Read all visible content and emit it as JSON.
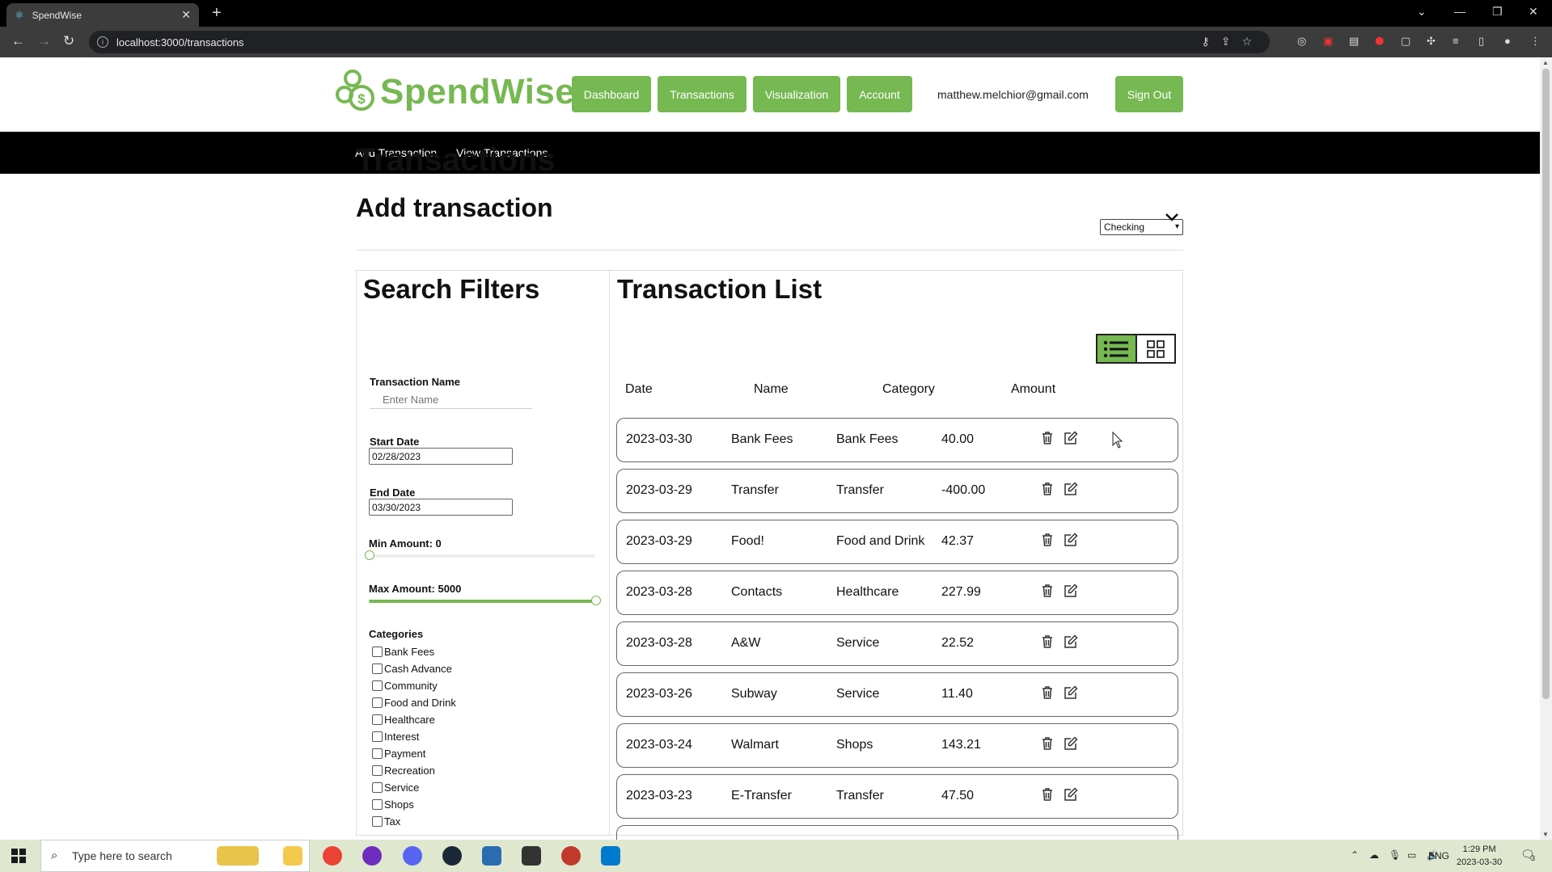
{
  "browser": {
    "tab_title": "SpendWise",
    "url": "localhost:3000/transactions"
  },
  "app": {
    "brand": "SpendWise",
    "nav": [
      "Dashboard",
      "Transactions",
      "Visualization",
      "Account"
    ],
    "user_email": "matthew.melchior@gmail.com",
    "sign_out": "Sign Out",
    "subnav": [
      "Add Transaction",
      "View Transactions"
    ],
    "accent_color": "#76b852"
  },
  "page": {
    "title": "Transactions",
    "account_selected": "Checking",
    "add_heading": "Add transaction"
  },
  "filters": {
    "title": "Search Filters",
    "name_label": "Transaction Name",
    "name_placeholder": "Enter Name",
    "start_label": "Start Date",
    "start_value": "02/28/2023",
    "end_label": "End Date",
    "end_value": "03/30/2023",
    "min_label": "Min Amount: 0",
    "min_value": 0,
    "max_label": "Max Amount: 5000",
    "max_value": 5000,
    "categories_label": "Categories",
    "categories": [
      "Bank Fees",
      "Cash Advance",
      "Community",
      "Food and Drink",
      "Healthcare",
      "Interest",
      "Payment",
      "Recreation",
      "Service",
      "Shops",
      "Tax"
    ]
  },
  "list": {
    "title": "Transaction List",
    "view_mode": "list",
    "columns": [
      "Date",
      "Name",
      "Category",
      "Amount"
    ],
    "rows": [
      {
        "date": "2023-03-30",
        "name": "Bank Fees",
        "category": "Bank Fees",
        "amount": "40.00"
      },
      {
        "date": "2023-03-29",
        "name": "Transfer",
        "category": "Transfer",
        "amount": "-400.00"
      },
      {
        "date": "2023-03-29",
        "name": "Food!",
        "category": "Food and Drink",
        "amount": "42.37"
      },
      {
        "date": "2023-03-28",
        "name": "Contacts",
        "category": "Healthcare",
        "amount": "227.99"
      },
      {
        "date": "2023-03-28",
        "name": "A&W",
        "category": "Service",
        "amount": "22.52"
      },
      {
        "date": "2023-03-26",
        "name": "Subway",
        "category": "Service",
        "amount": "11.40"
      },
      {
        "date": "2023-03-24",
        "name": "Walmart",
        "category": "Shops",
        "amount": "143.21"
      },
      {
        "date": "2023-03-23",
        "name": "E-Transfer",
        "category": "Transfer",
        "amount": "47.50"
      }
    ],
    "row_icons": [
      "trash-icon",
      "edit-icon"
    ]
  },
  "taskbar": {
    "search_placeholder": "Type here to search",
    "lang": "ENG",
    "time": "1:29 PM",
    "date": "2023-03-30",
    "notification_count": "3"
  }
}
